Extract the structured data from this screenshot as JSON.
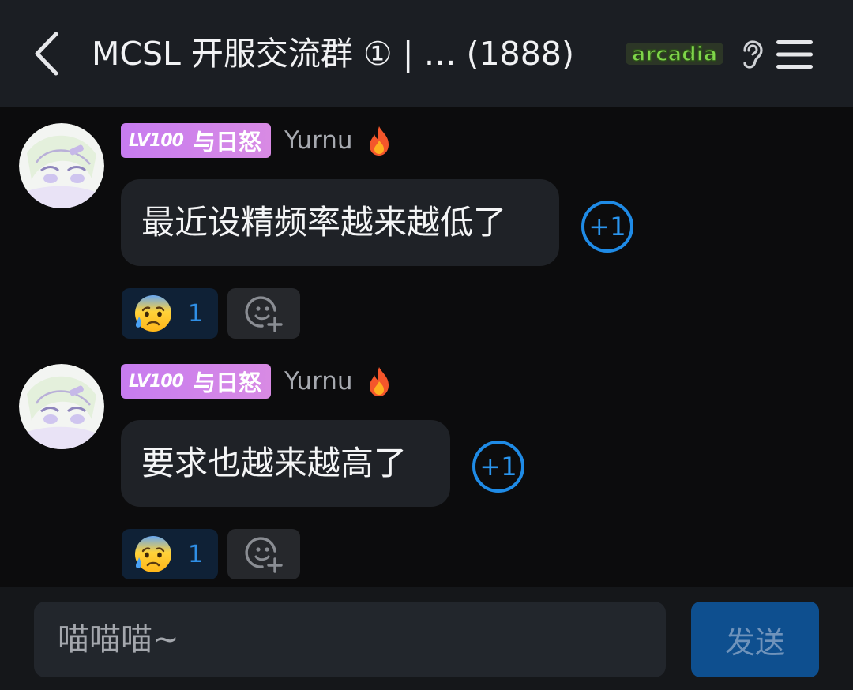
{
  "header": {
    "title": "MCSL 开服交流群 ① | …  (1888)",
    "logo_text": "arcadia",
    "back_icon": "chevron-left-icon",
    "ear_icon": "ear-icon",
    "menu_icon": "hamburger-menu-icon"
  },
  "messages": [
    {
      "level": "LV100",
      "member_title": "与日怒",
      "nickname": "Yurnu",
      "text": "最近设精频率越来越低了",
      "plus_one": "+1",
      "reaction_count": "1"
    },
    {
      "level": "LV100",
      "member_title": "与日怒",
      "nickname": "Yurnu",
      "text": "要求也越来越高了",
      "plus_one": "+1",
      "reaction_count": "1"
    }
  ],
  "composer": {
    "placeholder": "喵喵喵~",
    "send_label": "发送"
  },
  "colors": {
    "header_bg": "#1b1e23",
    "badge": "#c77cf0",
    "accent_blue": "#1f8be6",
    "send_bg": "#0e4f8f"
  }
}
